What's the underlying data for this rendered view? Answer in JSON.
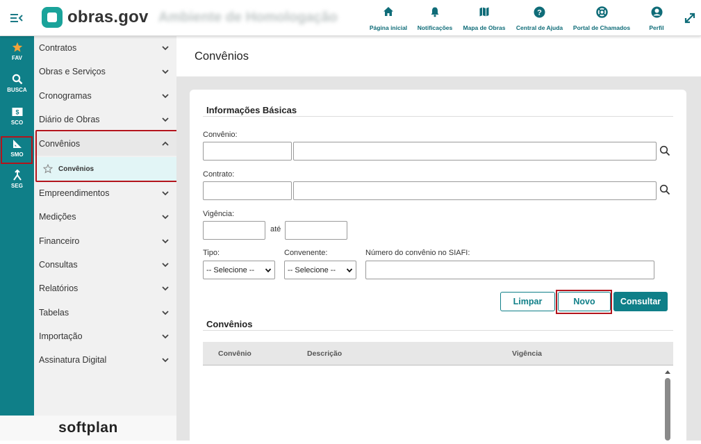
{
  "brand": {
    "name": "obras.gov",
    "environment": "Ambiente de Homologação"
  },
  "topnav": [
    {
      "label": "Página inicial",
      "icon": "home-icon"
    },
    {
      "label": "Notificações",
      "icon": "bell-icon"
    },
    {
      "label": "Mapa de Obras",
      "icon": "map-icon"
    },
    {
      "label": "Central de Ajuda",
      "icon": "help-icon"
    },
    {
      "label": "Portal de Chamados",
      "icon": "lifebuoy-icon"
    },
    {
      "label": "Perfil",
      "icon": "user-icon"
    }
  ],
  "rail": [
    {
      "label": "FAV",
      "icon": "star-icon"
    },
    {
      "label": "BUSCA",
      "icon": "search-icon"
    },
    {
      "label": "SCO",
      "icon": "money-icon"
    },
    {
      "label": "SMO",
      "icon": "ruler-icon"
    },
    {
      "label": "SEG",
      "icon": "fork-icon"
    }
  ],
  "sidebar": {
    "items": [
      {
        "label": "Contratos"
      },
      {
        "label": "Obras e Serviços"
      },
      {
        "label": "Cronogramas"
      },
      {
        "label": "Diário de Obras"
      },
      {
        "label": "Convênios"
      },
      {
        "label": "Empreendimentos"
      },
      {
        "label": "Medições"
      },
      {
        "label": "Financeiro"
      },
      {
        "label": "Consultas"
      },
      {
        "label": "Relatórios"
      },
      {
        "label": "Tabelas"
      },
      {
        "label": "Importação"
      },
      {
        "label": "Assinatura Digital"
      }
    ],
    "sub_item": "Convênios"
  },
  "footer": {
    "logo": "softplan"
  },
  "page": {
    "title": "Convênios"
  },
  "form": {
    "section_title": "Informações Básicas",
    "convenio_label": "Convênio:",
    "contrato_label": "Contrato:",
    "vigencia_label": "Vigência:",
    "ate_label": "até",
    "tipo_label": "Tipo:",
    "tipo_value": "-- Selecione --",
    "convenente_label": "Convenente:",
    "convenente_value": "-- Selecione --",
    "siafi_label": "Número do convênio no SIAFI:"
  },
  "buttons": {
    "limpar": "Limpar",
    "novo": "Novo",
    "consultar": "Consultar"
  },
  "results": {
    "section_title": "Convênios",
    "columns": [
      "Convênio",
      "Descrição",
      "Vigência"
    ]
  },
  "colors": {
    "accent": "#0f7f88",
    "highlight": "#b3141c",
    "rail": "#0f7f88"
  }
}
